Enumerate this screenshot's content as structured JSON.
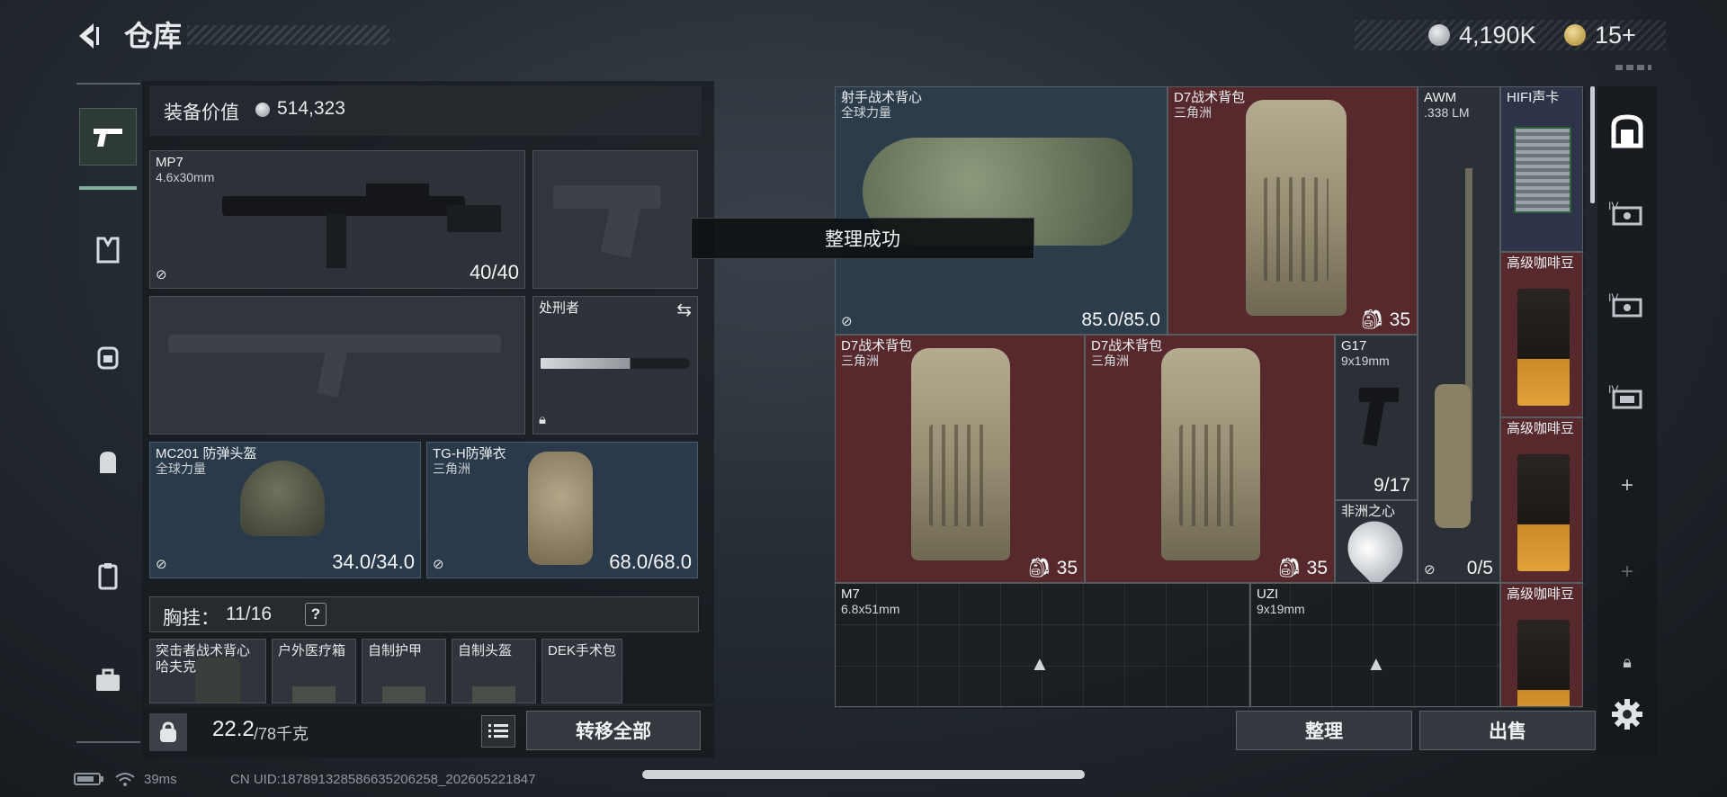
{
  "header": {
    "title": "仓库",
    "currency": [
      {
        "value": "4,190K",
        "icon": "silver-coin-icon"
      },
      {
        "value": "15+",
        "icon": "gold-coin-icon"
      }
    ]
  },
  "equipment": {
    "value_label": "装备价值",
    "value": "514,323",
    "slots": {
      "primary": {
        "name": "MP7",
        "sub": "4.6x30mm",
        "value": "40/40"
      },
      "melee": {
        "name": "处刑者"
      },
      "helmet": {
        "name": "MC201 防弹头盔",
        "sub": "全球力量",
        "value": "34.0/34.0"
      },
      "armor": {
        "name": "TG-H防弹衣",
        "sub": "三角洲",
        "value": "68.0/68.0"
      }
    },
    "chest_rig": {
      "label": "胸挂：",
      "count": "11/16",
      "help": "?"
    },
    "rig_items": [
      {
        "name": "突击者战术背心",
        "sub": "哈夫克"
      },
      {
        "name": "户外医疗箱"
      },
      {
        "name": "自制护甲"
      },
      {
        "name": "自制头盔"
      },
      {
        "name": "DEK手术包"
      }
    ],
    "weight": {
      "current": "22.2",
      "max": "/78千克"
    },
    "transfer_all": "转移全部"
  },
  "stash": {
    "items": [
      {
        "id": "vest",
        "name": "射手战术背心",
        "sub": "全球力量",
        "value": "85.0/85.0"
      },
      {
        "id": "d7a",
        "name": "D7战术背包",
        "sub": "三角洲",
        "value": "35"
      },
      {
        "id": "awm",
        "name": "AWM",
        "sub": ".338 LM",
        "value": "0/5"
      },
      {
        "id": "hifi",
        "name": "HIFI声卡"
      },
      {
        "id": "coffee1",
        "name": "高级咖啡豆"
      },
      {
        "id": "d7b",
        "name": "D7战术背包",
        "sub": "三角洲",
        "value": "35"
      },
      {
        "id": "d7c",
        "name": "D7战术背包",
        "sub": "三角洲",
        "value": "35"
      },
      {
        "id": "g17",
        "name": "G17",
        "sub": "9x19mm",
        "value": "9/17"
      },
      {
        "id": "coffee2",
        "name": "高级咖啡豆"
      },
      {
        "id": "heart",
        "name": "非洲之心"
      },
      {
        "id": "m7",
        "name": "M7",
        "sub": "6.8x51mm"
      },
      {
        "id": "uzi",
        "name": "UZI",
        "sub": "9x19mm"
      },
      {
        "id": "coffee3",
        "name": "高级咖啡豆"
      }
    ],
    "organize": "整理",
    "sell": "出售"
  },
  "toast": "整理成功",
  "rail": {
    "tabs": [
      "IV",
      "IV",
      "IV"
    ]
  },
  "status_bar": {
    "ping": "39ms",
    "uid": "CN UID:18789132858663520625​8_202605221847"
  },
  "colors": {
    "accent": "#7fb09e",
    "item_blue": "#2d3c4b",
    "item_red": "#57292c",
    "panel": "#2c3237"
  }
}
